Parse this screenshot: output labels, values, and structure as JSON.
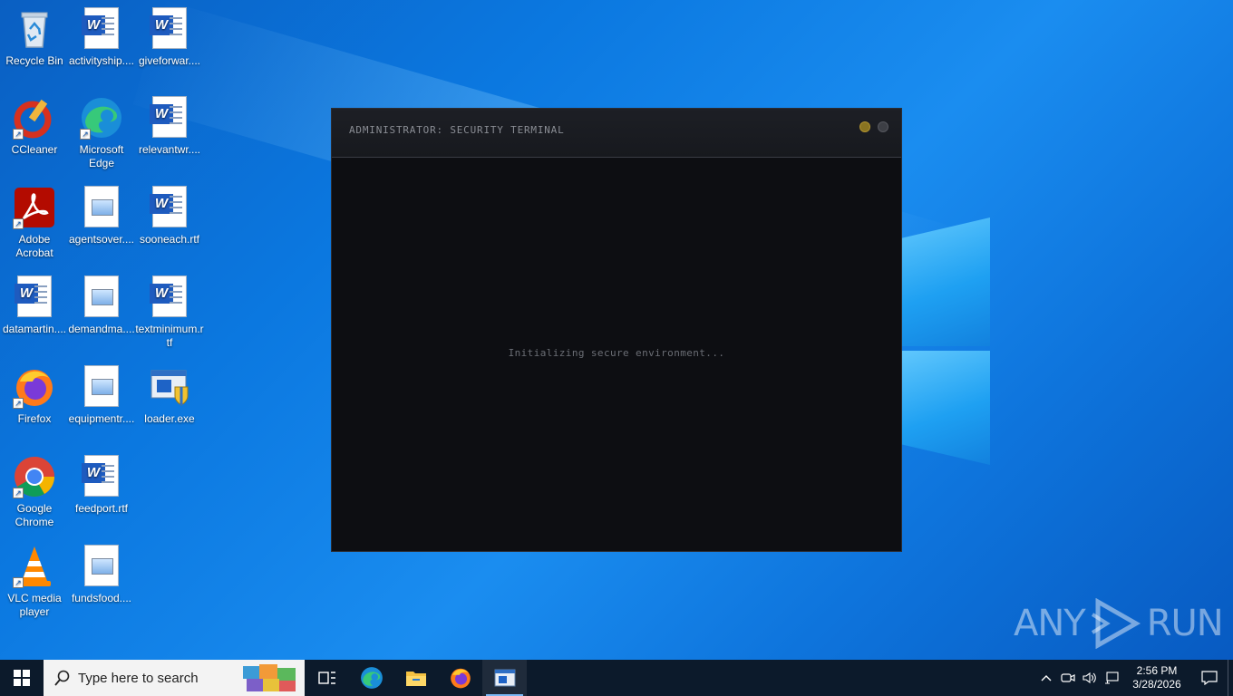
{
  "desktop": {
    "icons": [
      {
        "label": "Recycle Bin",
        "icon": "recycle-bin-icon"
      },
      {
        "label": "activityship....",
        "icon": "word-document-icon"
      },
      {
        "label": "giveforwar....",
        "icon": "word-document-icon"
      },
      {
        "label": "CCleaner",
        "icon": "ccleaner-icon"
      },
      {
        "label": "Microsoft Edge",
        "icon": "edge-icon"
      },
      {
        "label": "relevantwr....",
        "icon": "word-document-icon"
      },
      {
        "label": "Adobe Acrobat",
        "icon": "acrobat-icon"
      },
      {
        "label": "agentsover....",
        "icon": "image-file-icon"
      },
      {
        "label": "sooneach.rtf",
        "icon": "word-document-icon"
      },
      {
        "label": "datamartin....",
        "icon": "word-document-icon"
      },
      {
        "label": "demandma....",
        "icon": "image-file-icon"
      },
      {
        "label": "textminimum.rtf",
        "icon": "word-document-icon"
      },
      {
        "label": "Firefox",
        "icon": "firefox-icon"
      },
      {
        "label": "equipmentr....",
        "icon": "image-file-icon"
      },
      {
        "label": "loader.exe",
        "icon": "exe-installer-icon"
      },
      {
        "label": "Google Chrome",
        "icon": "chrome-icon"
      },
      {
        "label": "feedport.rtf",
        "icon": "word-document-icon"
      },
      {
        "label": "VLC media player",
        "icon": "vlc-icon"
      },
      {
        "label": "fundsfood....",
        "icon": "image-file-icon"
      }
    ]
  },
  "terminal": {
    "title": "ADMINISTRATOR: SECURITY TERMINAL",
    "status": "Initializing secure environment...",
    "dot_colors": [
      "#8a7421",
      "#3d3f45"
    ]
  },
  "watermark": {
    "left": "ANY",
    "right": "RUN"
  },
  "taskbar": {
    "search_placeholder": "Type here to search",
    "time": "2:56 PM",
    "date": "3/28/2026"
  },
  "colors": {
    "taskbar_bg": "#0c1a2b",
    "terminal_bg": "#0d0e12",
    "desktop_blue": "#0b78e0"
  }
}
